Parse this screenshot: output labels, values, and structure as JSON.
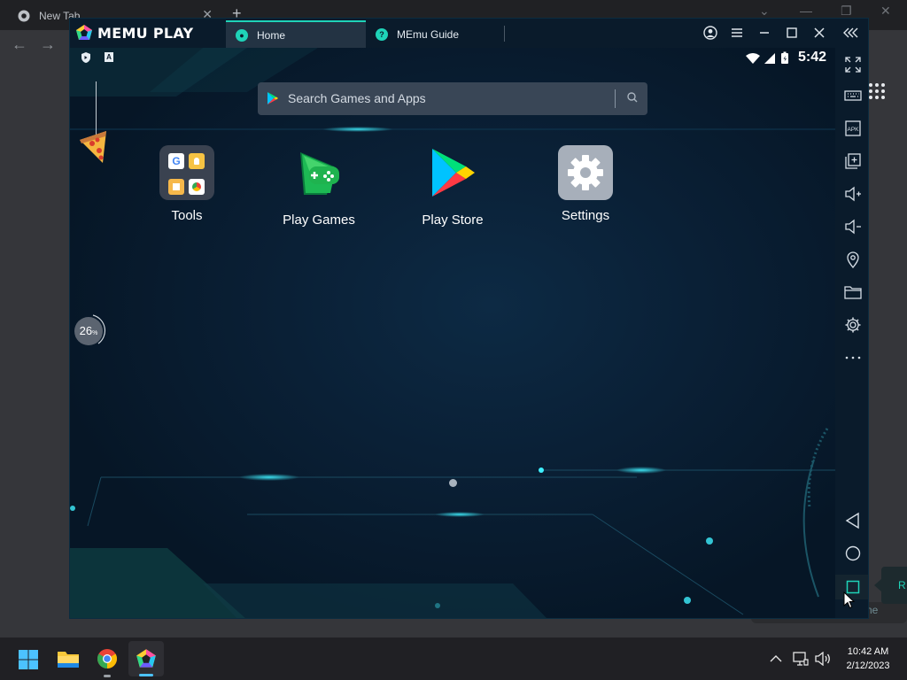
{
  "chrome": {
    "tab_title": "New Tab",
    "tab_close": "✕",
    "new_tab": "+",
    "back": "←",
    "forward": "→"
  },
  "memu": {
    "logo_text": "MEMU PLAY",
    "tabs": [
      {
        "label": "Home",
        "active": true
      },
      {
        "label": "MEmu Guide",
        "active": false
      }
    ],
    "window_controls": [
      "account-icon",
      "menu-icon",
      "minimize-icon",
      "maximize-icon",
      "close-icon",
      "collapse-sidebar-icon"
    ]
  },
  "android": {
    "status_badge_text": "A",
    "clock": "5:42",
    "search_placeholder": "Search Games and Apps",
    "apps": [
      {
        "label": "Tools"
      },
      {
        "label": "Play Games"
      },
      {
        "label": "Play Store"
      },
      {
        "label": "Settings"
      }
    ],
    "cleanup_badge": "26",
    "cleanup_badge_unit": "%"
  },
  "sidebar_tools": [
    "fullscreen-icon",
    "keyboard-icon",
    "apk-icon",
    "multi-instance-icon",
    "volume-up-icon",
    "volume-down-icon",
    "location-icon",
    "folder-icon",
    "settings-icon",
    "more-icon",
    "back-icon",
    "home-icon",
    "recent-apps-icon"
  ],
  "tooltip": {
    "text": "R",
    "under_text": "ne"
  },
  "taskbar": {
    "time": "10:42 AM",
    "date": "2/12/2023",
    "pinned": [
      "start-icon",
      "file-explorer-icon",
      "chrome-icon",
      "memu-icon"
    ],
    "tray": [
      "chevron-up-icon",
      "network-icon",
      "volume-icon"
    ]
  },
  "colors": {
    "accent": "#1fd3b8",
    "memu_bg": "#061626",
    "taskbar_bg": "#202024"
  }
}
